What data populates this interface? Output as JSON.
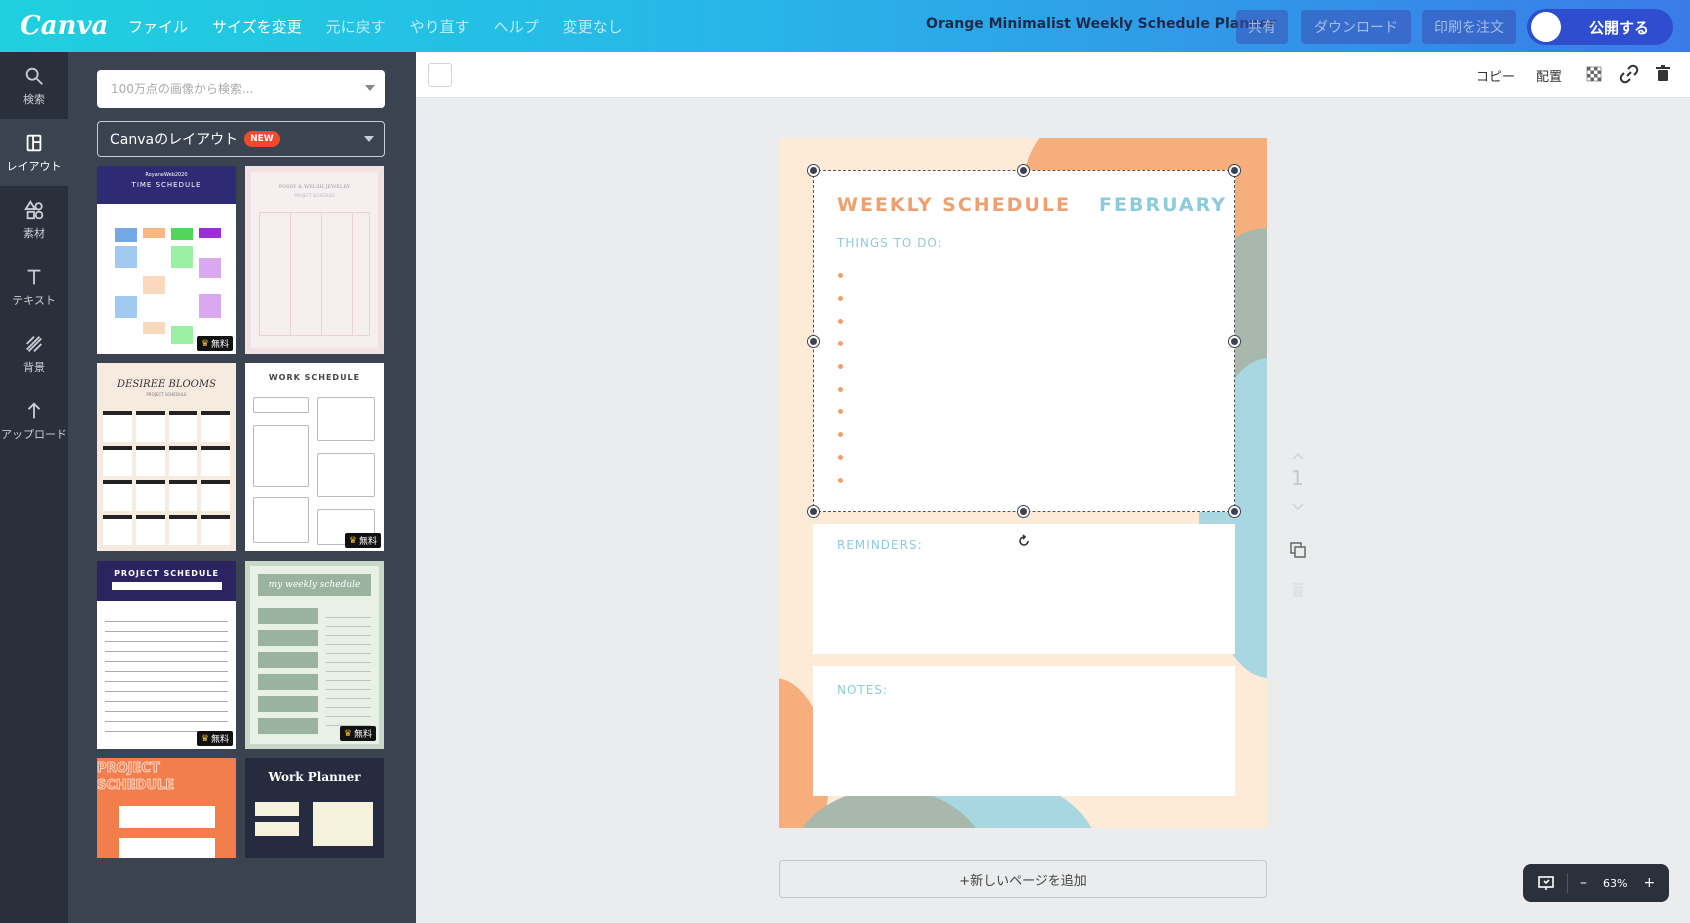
{
  "app": {
    "logo": "Canva",
    "menu": [
      "ファイル",
      "サイズを変更",
      "元に戻す",
      "やり直す",
      "ヘルプ",
      "変更なし"
    ],
    "document_title": "Orange Minimalist Weekly Schedule Planner",
    "share": "共有",
    "download": "ダウンロード",
    "print": "印刷を注文",
    "publish": "公開する"
  },
  "rail": [
    {
      "label": "検索",
      "icon": "search-icon"
    },
    {
      "label": "レイアウト",
      "icon": "layout-icon"
    },
    {
      "label": "素材",
      "icon": "elements-icon"
    },
    {
      "label": "テキスト",
      "icon": "text-icon"
    },
    {
      "label": "背景",
      "icon": "background-icon"
    },
    {
      "label": "アップロード",
      "icon": "upload-icon"
    }
  ],
  "panel": {
    "search_placeholder": "100万点の画像から検索...",
    "layout_select": "Canvaのレイアウト",
    "new_badge": "NEW",
    "free_label": "無料",
    "templates": [
      {
        "title": "TIME SCHEDULE",
        "subtitle": "RoyaneWeb2020"
      },
      {
        "title": "POSSY & WELSH JEWELRY",
        "subtitle": "PROJECT SCHEDULE"
      },
      {
        "title": "DESIREE BLOOMS",
        "subtitle": "PROJECT SCHEDULE"
      },
      {
        "title": "WORK SCHEDULE",
        "subtitle": ""
      },
      {
        "title": "PROJECT SCHEDULE",
        "subtitle": ""
      },
      {
        "title": "my weekly schedule",
        "subtitle": ""
      },
      {
        "title": "PROJECT SCHEDULE",
        "subtitle": ""
      },
      {
        "title": "Work Planner",
        "subtitle": ""
      }
    ]
  },
  "toolbar": {
    "copy": "コピー",
    "arrange": "配置"
  },
  "page": {
    "weekly": "WEEKLY SCHEDULE",
    "month": "FEBRUARY",
    "things": "THINGS TO DO:",
    "reminders": "REMINDERS:",
    "notes": "NOTES:",
    "bullet_count": 10,
    "page_number": "1"
  },
  "add_page": "+新しいページを追加",
  "zoom": {
    "minus": "–",
    "level": "63%",
    "plus": "+"
  },
  "colors": {
    "orange": "#f0a06e",
    "blue": "#8ccbdc",
    "sage": "#a9b8ad",
    "peach": "#fdebd8"
  }
}
